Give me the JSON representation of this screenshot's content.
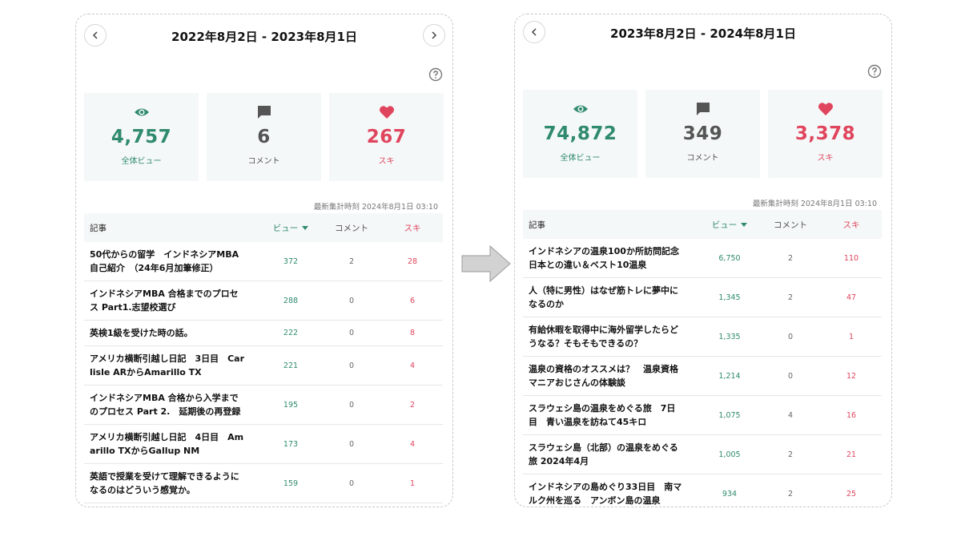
{
  "left_panel": {
    "title": "2022年8月2日 - 2023年8月1日",
    "stats": {
      "views_value": "4,757",
      "views_label": "全体ビュー",
      "comments_value": "6",
      "comments_label": "コメント",
      "likes_value": "267",
      "likes_label": "スキ"
    },
    "updated": "最新集計時刻 2024年8月1日 03:10",
    "headers": {
      "title": "記事",
      "views": "ビュー",
      "comments": "コメント",
      "likes": "スキ"
    },
    "rows": [
      {
        "line1": "50代からの留学　インドネシアMBA",
        "line2": "自己紹介　（24年6月加筆修正）",
        "views": "372",
        "comments": "2",
        "likes": "28"
      },
      {
        "line1": "インドネシアMBA 合格までのプロセ",
        "line2": "ス Part1.志望校選び",
        "views": "288",
        "comments": "0",
        "likes": "6"
      },
      {
        "line1": "英検1級を受けた時の話。",
        "line2": "",
        "views": "222",
        "comments": "0",
        "likes": "8"
      },
      {
        "line1": "アメリカ横断引越し日記　3日目　Car",
        "line2": "lisle ARからAmarillo TX",
        "views": "221",
        "comments": "0",
        "likes": "4"
      },
      {
        "line1": "インドネシアMBA 合格から入学まで",
        "line2": "のプロセス Part 2.　延期後の再登録",
        "views": "195",
        "comments": "0",
        "likes": "2"
      },
      {
        "line1": "アメリカ横断引越し日記　4日目　Am",
        "line2": "arillo TXからGallup NM",
        "views": "173",
        "comments": "0",
        "likes": "4"
      },
      {
        "line1": "英語で授業を受けて理解できるように",
        "line2": "なるのはどういう感覚か。",
        "views": "159",
        "comments": "0",
        "likes": "1"
      }
    ]
  },
  "right_panel": {
    "title": "2023年8月2日 - 2024年8月1日",
    "stats": {
      "views_value": "74,872",
      "views_label": "全体ビュー",
      "comments_value": "349",
      "comments_label": "コメント",
      "likes_value": "3,378",
      "likes_label": "スキ"
    },
    "updated": "最新集計時刻 2024年8月1日 03:10",
    "headers": {
      "title": "記事",
      "views": "ビュー",
      "comments": "コメント",
      "likes": "スキ"
    },
    "rows": [
      {
        "line1": "インドネシアの温泉100か所訪問記念",
        "line2": "日本との違い＆ベスト10温泉",
        "views": "6,750",
        "comments": "2",
        "likes": "110"
      },
      {
        "line1": "人（特に男性）はなぜ筋トレに夢中に",
        "line2": "なるのか",
        "views": "1,345",
        "comments": "2",
        "likes": "47"
      },
      {
        "line1": "有給休暇を取得中に海外留学したらど",
        "line2": "うなる？そもそもできるの？",
        "views": "1,335",
        "comments": "0",
        "likes": "1"
      },
      {
        "line1": "温泉の資格のオススメは？　温泉資格",
        "line2": "マニアおじさんの体験談",
        "views": "1,214",
        "comments": "0",
        "likes": "12"
      },
      {
        "line1": "スラウェシ島の温泉をめぐる旅　7日",
        "line2": "目　青い温泉を訪ねて45キロ",
        "views": "1,075",
        "comments": "4",
        "likes": "16"
      },
      {
        "line1": "スラウェシ島（北部）の温泉をめぐる",
        "line2": "旅 2024年4月",
        "views": "1,005",
        "comments": "2",
        "likes": "21"
      },
      {
        "line1": "インドネシアの島めぐり33日目　南マ",
        "line2": "ルク州を巡る　アンボン島の温泉",
        "views": "934",
        "comments": "2",
        "likes": "25"
      }
    ]
  },
  "colors": {
    "views": "#2f8a6e",
    "comments": "#555555",
    "likes": "#e0455e",
    "card_bg": "#f5f8f8"
  },
  "icons": {
    "prev": "chevron-left-icon",
    "next": "chevron-right-icon",
    "help": "help-circle-icon",
    "views": "eye-icon",
    "comments": "speech-bubble-icon",
    "likes": "heart-icon",
    "arrow": "right-arrow-icon"
  }
}
